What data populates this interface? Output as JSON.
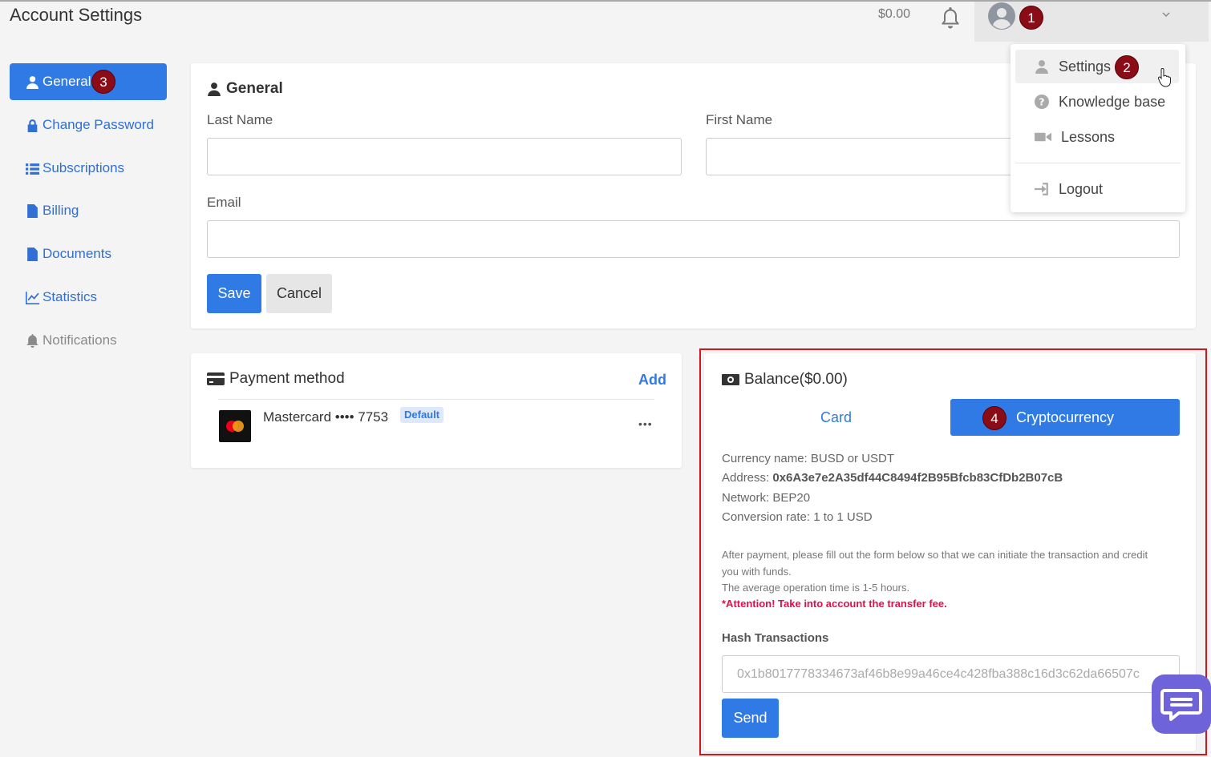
{
  "header": {
    "title": "Account Settings",
    "balance": "$0.00",
    "step1": "1"
  },
  "user_menu": {
    "items": [
      {
        "label": "Settings",
        "icon": "user-icon"
      },
      {
        "label": "Knowledge base",
        "icon": "question-circle-icon"
      },
      {
        "label": "Lessons",
        "icon": "video-camera-icon"
      },
      {
        "label": "Logout",
        "icon": "sign-in-icon"
      }
    ],
    "step2": "2"
  },
  "sidebar": {
    "items": [
      {
        "label": "General",
        "icon": "user-icon"
      },
      {
        "label": "Change Password",
        "icon": "lock-icon"
      },
      {
        "label": "Subscriptions",
        "icon": "list-icon"
      },
      {
        "label": "Billing",
        "icon": "file-text-icon"
      },
      {
        "label": "Documents",
        "icon": "file-icon"
      },
      {
        "label": "Statistics",
        "icon": "line-chart-icon"
      },
      {
        "label": "Notifications",
        "icon": "bell-icon"
      }
    ],
    "step3": "3"
  },
  "general": {
    "title": "General",
    "last_name_label": "Last Name",
    "last_name_value": "",
    "first_name_label": "First Name",
    "first_name_value": "",
    "email_label": "Email",
    "email_value": "",
    "save_label": "Save",
    "cancel_label": "Cancel"
  },
  "payment": {
    "title": "Payment method",
    "add_label": "Add",
    "card_name": "Mastercard •••• 7753",
    "default_badge": "Default",
    "more_label": "•••"
  },
  "balance": {
    "title": "Balance($0.00)",
    "tabs": [
      {
        "label": "Card",
        "active": false
      },
      {
        "label": "Cryptocurrency",
        "active": true
      }
    ],
    "step4": "4",
    "currency_name": "Currency name: BUSD or USDT",
    "address_label": "Address: ",
    "address_value": "0x6A3e7e2A35df44C8494f2B95Bfcb83CfDb2B07cB",
    "network": "Network: BEP20",
    "conversion": "Conversion rate: 1 to 1 USD",
    "note_line1": "After payment, please fill out the form below so that we can initiate the transaction and credit",
    "note_line2": "you with funds.",
    "note_line3": "The average operation time is 1-5 hours.",
    "attention": "*Attention! Take into account the transfer fee.",
    "hash_label": "Hash Transactions",
    "hash_placeholder": "0x1b8017778334673af46b8e99a46ce4c428fba388c16d3c62da66507c",
    "send_label": "Send"
  },
  "colors": {
    "primary": "#2f7ae5",
    "step_badge": "#8a0c16",
    "highlight_border": "#d7141e",
    "attention": "#e0104a",
    "chat": "#6e63d8"
  }
}
